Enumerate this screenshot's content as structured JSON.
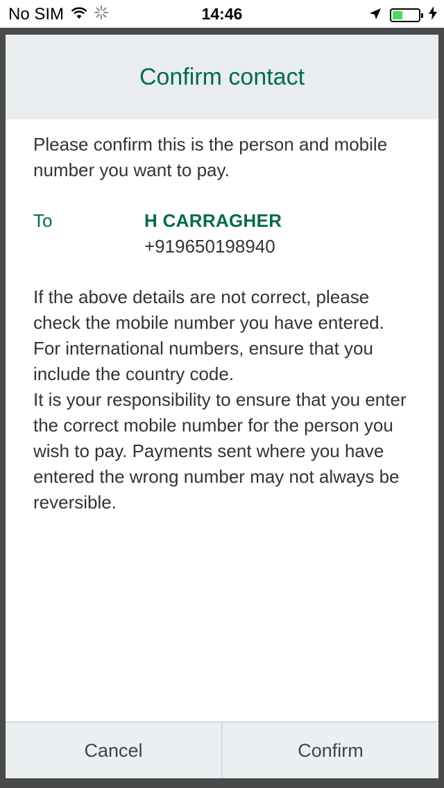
{
  "status_bar": {
    "carrier": "No SIM",
    "time": "14:46",
    "battery_level": 0.4
  },
  "dialog": {
    "title": "Confirm contact",
    "intro": "Please confirm this is the person and mobile number you want to pay.",
    "to_label": "To",
    "payee_name": "H CARRAGHER",
    "payee_number": "+919650198940",
    "notice_1": "If the above details are not correct, please check the mobile number you have entered. For international numbers, ensure that you include the country code.",
    "notice_2": "It is your responsibility to ensure that you enter the correct mobile number for the person you wish to pay. Payments sent where you have entered the wrong number may not always be reversible.",
    "cancel_label": "Cancel",
    "confirm_label": "Confirm"
  },
  "colors": {
    "accent": "#006a4d",
    "header_bg": "#e9edf0",
    "footer_bg": "#eceff1"
  }
}
